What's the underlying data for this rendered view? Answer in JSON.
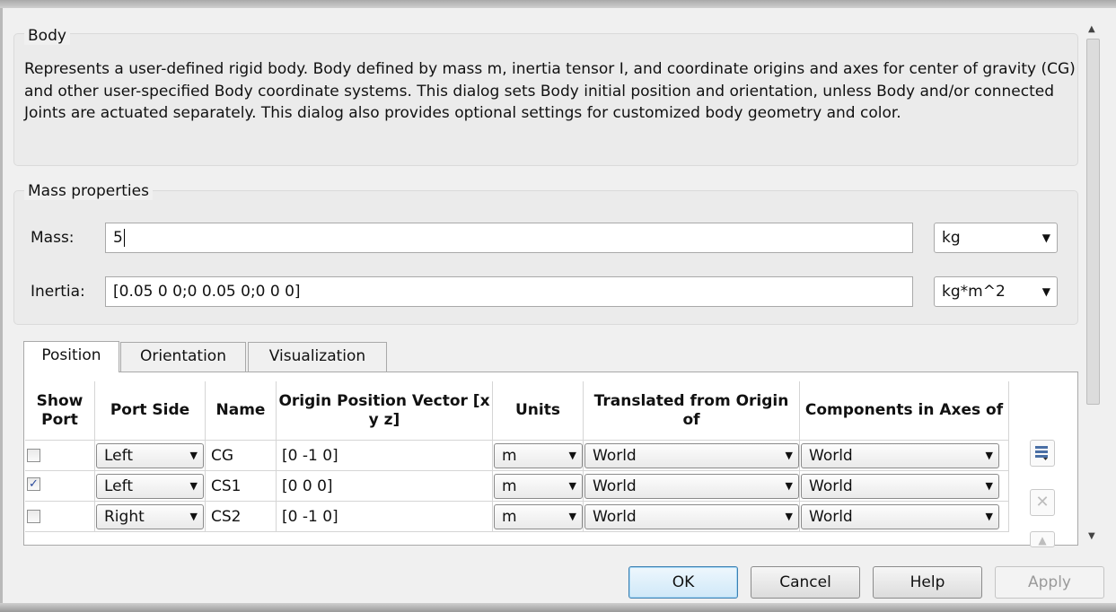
{
  "body_group": {
    "legend": "Body",
    "description": "Represents a user-defined rigid body. Body defined by mass m, inertia tensor I, and coordinate origins and axes for center of gravity (CG) and other user-specified Body coordinate systems. This dialog sets Body initial position and orientation, unless Body and/or connected Joints are actuated separately. This dialog also provides optional settings for customized body geometry and color."
  },
  "mass_group": {
    "legend": "Mass properties",
    "mass_label": "Mass:",
    "mass_value": "5",
    "mass_unit": "kg",
    "inertia_label": "Inertia:",
    "inertia_value": "[0.05 0 0;0 0.05 0;0 0 0]",
    "inertia_unit": "kg*m^2"
  },
  "tabs": [
    {
      "label": "Position",
      "active": true
    },
    {
      "label": "Orientation",
      "active": false
    },
    {
      "label": "Visualization",
      "active": false
    }
  ],
  "table": {
    "headers": {
      "show_port": "Show Port",
      "port_side": "Port Side",
      "name": "Name",
      "origin": "Origin Position Vector [x y z]",
      "units": "Units",
      "translated": "Translated from Origin of",
      "components": "Components in Axes of"
    },
    "rows": [
      {
        "show_port": false,
        "port_side": "Left",
        "name": "CG",
        "origin": "[0 -1 0]",
        "units": "m",
        "translated": "World",
        "components": "World"
      },
      {
        "show_port": true,
        "port_side": "Left",
        "name": "CS1",
        "origin": "[0 0 0]",
        "units": "m",
        "translated": "World",
        "components": "World"
      },
      {
        "show_port": false,
        "port_side": "Right",
        "name": "CS2",
        "origin": "[0 -1 0]",
        "units": "m",
        "translated": "World",
        "components": "World"
      }
    ]
  },
  "icons": {
    "add_row": "add-row-icon",
    "delete_row": "delete-row-icon",
    "move_up": "move-up-icon"
  },
  "buttons": {
    "ok": "OK",
    "cancel": "Cancel",
    "help": "Help",
    "apply": "Apply"
  },
  "colors": {
    "default_button_border": "#3c7fb1",
    "checkmark": "#2a4a9c"
  }
}
